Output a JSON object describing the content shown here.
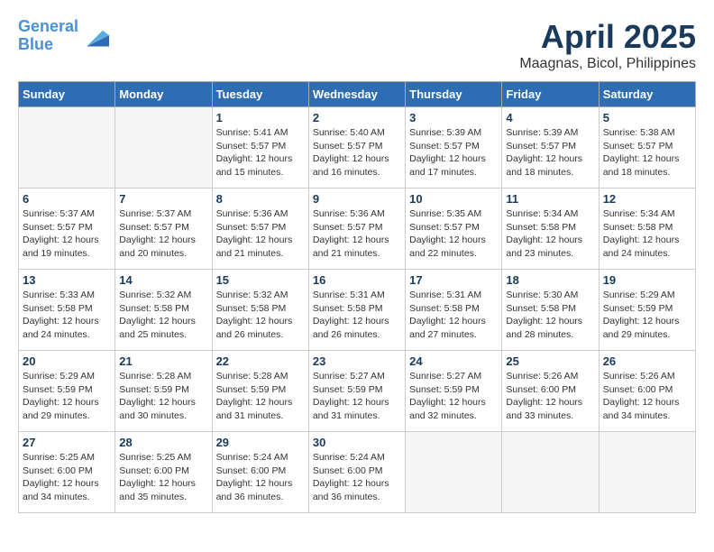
{
  "header": {
    "logo_line1": "General",
    "logo_line2": "Blue",
    "month": "April 2025",
    "location": "Maagnas, Bicol, Philippines"
  },
  "weekdays": [
    "Sunday",
    "Monday",
    "Tuesday",
    "Wednesday",
    "Thursday",
    "Friday",
    "Saturday"
  ],
  "weeks": [
    [
      {
        "day": "",
        "sunrise": "",
        "sunset": "",
        "daylight": ""
      },
      {
        "day": "",
        "sunrise": "",
        "sunset": "",
        "daylight": ""
      },
      {
        "day": "1",
        "sunrise": "Sunrise: 5:41 AM",
        "sunset": "Sunset: 5:57 PM",
        "daylight": "Daylight: 12 hours and 15 minutes."
      },
      {
        "day": "2",
        "sunrise": "Sunrise: 5:40 AM",
        "sunset": "Sunset: 5:57 PM",
        "daylight": "Daylight: 12 hours and 16 minutes."
      },
      {
        "day": "3",
        "sunrise": "Sunrise: 5:39 AM",
        "sunset": "Sunset: 5:57 PM",
        "daylight": "Daylight: 12 hours and 17 minutes."
      },
      {
        "day": "4",
        "sunrise": "Sunrise: 5:39 AM",
        "sunset": "Sunset: 5:57 PM",
        "daylight": "Daylight: 12 hours and 18 minutes."
      },
      {
        "day": "5",
        "sunrise": "Sunrise: 5:38 AM",
        "sunset": "Sunset: 5:57 PM",
        "daylight": "Daylight: 12 hours and 18 minutes."
      }
    ],
    [
      {
        "day": "6",
        "sunrise": "Sunrise: 5:37 AM",
        "sunset": "Sunset: 5:57 PM",
        "daylight": "Daylight: 12 hours and 19 minutes."
      },
      {
        "day": "7",
        "sunrise": "Sunrise: 5:37 AM",
        "sunset": "Sunset: 5:57 PM",
        "daylight": "Daylight: 12 hours and 20 minutes."
      },
      {
        "day": "8",
        "sunrise": "Sunrise: 5:36 AM",
        "sunset": "Sunset: 5:57 PM",
        "daylight": "Daylight: 12 hours and 21 minutes."
      },
      {
        "day": "9",
        "sunrise": "Sunrise: 5:36 AM",
        "sunset": "Sunset: 5:57 PM",
        "daylight": "Daylight: 12 hours and 21 minutes."
      },
      {
        "day": "10",
        "sunrise": "Sunrise: 5:35 AM",
        "sunset": "Sunset: 5:57 PM",
        "daylight": "Daylight: 12 hours and 22 minutes."
      },
      {
        "day": "11",
        "sunrise": "Sunrise: 5:34 AM",
        "sunset": "Sunset: 5:58 PM",
        "daylight": "Daylight: 12 hours and 23 minutes."
      },
      {
        "day": "12",
        "sunrise": "Sunrise: 5:34 AM",
        "sunset": "Sunset: 5:58 PM",
        "daylight": "Daylight: 12 hours and 24 minutes."
      }
    ],
    [
      {
        "day": "13",
        "sunrise": "Sunrise: 5:33 AM",
        "sunset": "Sunset: 5:58 PM",
        "daylight": "Daylight: 12 hours and 24 minutes."
      },
      {
        "day": "14",
        "sunrise": "Sunrise: 5:32 AM",
        "sunset": "Sunset: 5:58 PM",
        "daylight": "Daylight: 12 hours and 25 minutes."
      },
      {
        "day": "15",
        "sunrise": "Sunrise: 5:32 AM",
        "sunset": "Sunset: 5:58 PM",
        "daylight": "Daylight: 12 hours and 26 minutes."
      },
      {
        "day": "16",
        "sunrise": "Sunrise: 5:31 AM",
        "sunset": "Sunset: 5:58 PM",
        "daylight": "Daylight: 12 hours and 26 minutes."
      },
      {
        "day": "17",
        "sunrise": "Sunrise: 5:31 AM",
        "sunset": "Sunset: 5:58 PM",
        "daylight": "Daylight: 12 hours and 27 minutes."
      },
      {
        "day": "18",
        "sunrise": "Sunrise: 5:30 AM",
        "sunset": "Sunset: 5:58 PM",
        "daylight": "Daylight: 12 hours and 28 minutes."
      },
      {
        "day": "19",
        "sunrise": "Sunrise: 5:29 AM",
        "sunset": "Sunset: 5:59 PM",
        "daylight": "Daylight: 12 hours and 29 minutes."
      }
    ],
    [
      {
        "day": "20",
        "sunrise": "Sunrise: 5:29 AM",
        "sunset": "Sunset: 5:59 PM",
        "daylight": "Daylight: 12 hours and 29 minutes."
      },
      {
        "day": "21",
        "sunrise": "Sunrise: 5:28 AM",
        "sunset": "Sunset: 5:59 PM",
        "daylight": "Daylight: 12 hours and 30 minutes."
      },
      {
        "day": "22",
        "sunrise": "Sunrise: 5:28 AM",
        "sunset": "Sunset: 5:59 PM",
        "daylight": "Daylight: 12 hours and 31 minutes."
      },
      {
        "day": "23",
        "sunrise": "Sunrise: 5:27 AM",
        "sunset": "Sunset: 5:59 PM",
        "daylight": "Daylight: 12 hours and 31 minutes."
      },
      {
        "day": "24",
        "sunrise": "Sunrise: 5:27 AM",
        "sunset": "Sunset: 5:59 PM",
        "daylight": "Daylight: 12 hours and 32 minutes."
      },
      {
        "day": "25",
        "sunrise": "Sunrise: 5:26 AM",
        "sunset": "Sunset: 6:00 PM",
        "daylight": "Daylight: 12 hours and 33 minutes."
      },
      {
        "day": "26",
        "sunrise": "Sunrise: 5:26 AM",
        "sunset": "Sunset: 6:00 PM",
        "daylight": "Daylight: 12 hours and 34 minutes."
      }
    ],
    [
      {
        "day": "27",
        "sunrise": "Sunrise: 5:25 AM",
        "sunset": "Sunset: 6:00 PM",
        "daylight": "Daylight: 12 hours and 34 minutes."
      },
      {
        "day": "28",
        "sunrise": "Sunrise: 5:25 AM",
        "sunset": "Sunset: 6:00 PM",
        "daylight": "Daylight: 12 hours and 35 minutes."
      },
      {
        "day": "29",
        "sunrise": "Sunrise: 5:24 AM",
        "sunset": "Sunset: 6:00 PM",
        "daylight": "Daylight: 12 hours and 36 minutes."
      },
      {
        "day": "30",
        "sunrise": "Sunrise: 5:24 AM",
        "sunset": "Sunset: 6:00 PM",
        "daylight": "Daylight: 12 hours and 36 minutes."
      },
      {
        "day": "",
        "sunrise": "",
        "sunset": "",
        "daylight": ""
      },
      {
        "day": "",
        "sunrise": "",
        "sunset": "",
        "daylight": ""
      },
      {
        "day": "",
        "sunrise": "",
        "sunset": "",
        "daylight": ""
      }
    ]
  ]
}
